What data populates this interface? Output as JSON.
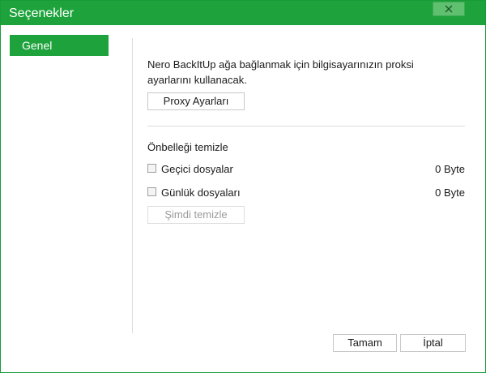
{
  "window": {
    "title": "Seçenekler"
  },
  "sidebar": {
    "items": [
      {
        "label": "Genel",
        "selected": true
      }
    ]
  },
  "general": {
    "proxy_description": "Nero BackItUp ağa bağlanmak için bilgisayarınızın proksi ayarlarını kullanacak.",
    "proxy_button": "Proxy Ayarları",
    "cache_title": "Önbelleği temizle",
    "cache_items": [
      {
        "label": "Geçici dosyalar",
        "size": "0 Byte",
        "checked": false
      },
      {
        "label": "Günlük dosyaları",
        "size": "0 Byte",
        "checked": false
      }
    ],
    "clear_button": "Şimdi temizle",
    "clear_button_disabled": true
  },
  "footer": {
    "ok_label": "Tamam",
    "cancel_label": "İptal"
  },
  "colors": {
    "accent": "#1ea23c",
    "close_button": "#5fc06f"
  }
}
